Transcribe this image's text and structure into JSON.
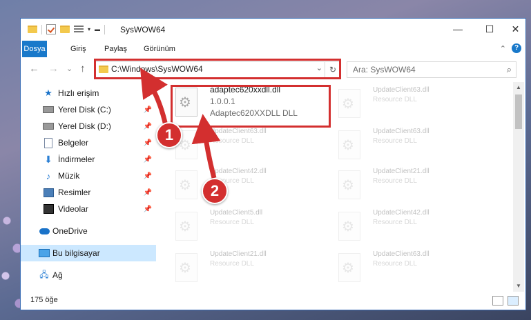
{
  "window": {
    "title": "SysWOW64",
    "minimize": "—",
    "maximize": "☐",
    "close": "✕"
  },
  "ribbon": {
    "tabs": [
      "Dosya",
      "Giriş",
      "Paylaş",
      "Görünüm"
    ],
    "collapse": "⌃",
    "help": "?"
  },
  "nav": {
    "back": "←",
    "forward": "→",
    "recent": "⌄",
    "up": "↑"
  },
  "address": {
    "path": "C:\\Windows\\SysWOW64",
    "dropdown": "⌄",
    "refresh": "↻"
  },
  "search": {
    "placeholder": "Ara: SysWOW64",
    "icon": "⌕"
  },
  "sidebar": {
    "items": [
      {
        "label": "Hızlı erişim",
        "icon": "star-icon"
      },
      {
        "label": "Yerel Disk (C:)",
        "icon": "disk-icon",
        "pinned": true
      },
      {
        "label": "Yerel Disk (D:)",
        "icon": "disk-icon",
        "pinned": true
      },
      {
        "label": "Belgeler",
        "icon": "document-icon",
        "pinned": true
      },
      {
        "label": "İndirmeler",
        "icon": "download-icon",
        "pinned": true
      },
      {
        "label": "Müzik",
        "icon": "music-icon",
        "pinned": true
      },
      {
        "label": "Resimler",
        "icon": "pictures-icon",
        "pinned": true
      },
      {
        "label": "Videolar",
        "icon": "video-icon",
        "pinned": true
      },
      {
        "label": "OneDrive",
        "icon": "cloud-icon"
      },
      {
        "label": "Bu bilgisayar",
        "icon": "computer-icon",
        "selected": true
      },
      {
        "label": "Ağ",
        "icon": "network-icon"
      }
    ],
    "pin_glyph": "📌"
  },
  "files": [
    {
      "name": "adaptec620xxdll.dll",
      "line2": "1.0.0.1",
      "line3": "Adaptec620XXDLL DLL"
    },
    {
      "name": "UpdateClient63.dll",
      "line2": "Resource DLL"
    },
    {
      "name": "UpdateClient63.dll",
      "line2": "Resource DLL"
    },
    {
      "name": "UpdateClient63.dll",
      "line2": "Resource DLL"
    },
    {
      "name": "UpdateClient42.dll",
      "line2": "Resource DLL"
    },
    {
      "name": "UpdateClient21.dll",
      "line2": "Resource DLL"
    },
    {
      "name": "UpdateClient5.dll",
      "line2": "Resource DLL"
    },
    {
      "name": "UpdateClient42.dll",
      "line2": "Resource DLL"
    },
    {
      "name": "UpdateClient21.dll",
      "line2": "Resource DLL"
    },
    {
      "name": "UpdateClient63.dll",
      "line2": "Resource DLL"
    }
  ],
  "status": {
    "count": "175 öğe"
  },
  "annotations": {
    "badge1": "1",
    "badge2": "2",
    "color": "#d32f2f"
  },
  "colors": {
    "accent": "#1979ca",
    "selection": "#cce8ff"
  }
}
